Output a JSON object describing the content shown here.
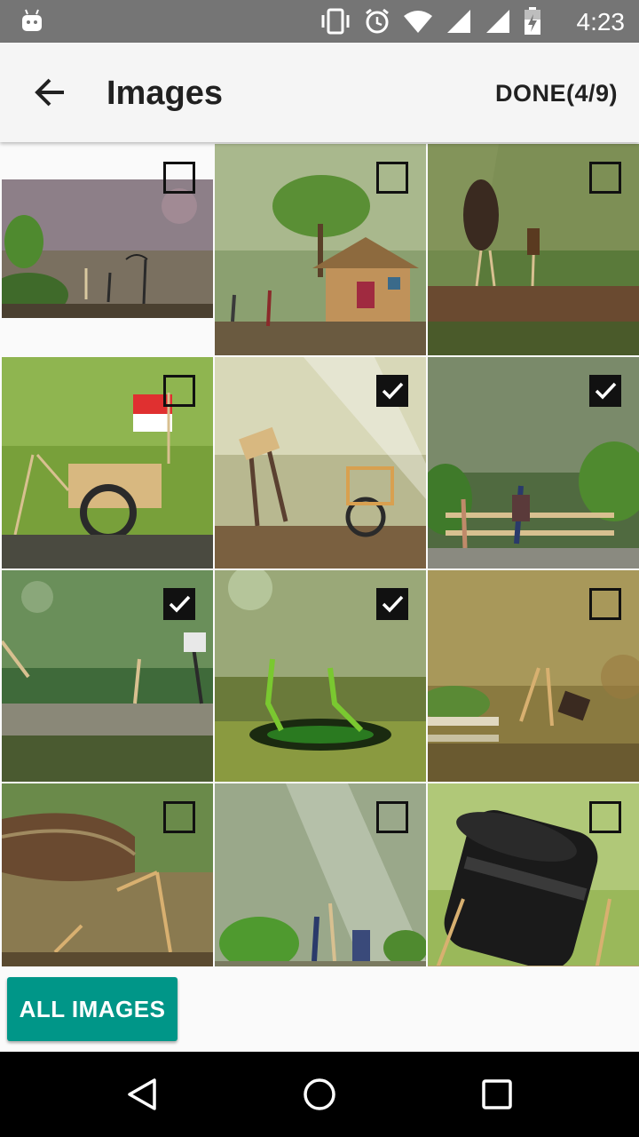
{
  "status_bar": {
    "time": "4:23",
    "icons": [
      "android-icon",
      "vibrate-icon",
      "alarm-icon",
      "wifi-icon",
      "signal-icon",
      "signal-icon",
      "battery-icon"
    ]
  },
  "app_bar": {
    "title": "Images",
    "done_label": "DONE(4/9)",
    "back_icon": "arrow-back-icon"
  },
  "grid": {
    "images": [
      {
        "label": "matchstick figures in rain",
        "selected": false
      },
      {
        "label": "matchstick figures by wooden house",
        "selected": false
      },
      {
        "label": "matchstick figures on branch",
        "selected": false
      },
      {
        "label": "matchstick cart with flag",
        "selected": false
      },
      {
        "label": "matchstick figure with wheelchair",
        "selected": true
      },
      {
        "label": "matchstick couple on bench",
        "selected": true
      },
      {
        "label": "matchstick figures on log",
        "selected": true
      },
      {
        "label": "matchstick figure in hole",
        "selected": true
      },
      {
        "label": "matchstick figures at bench",
        "selected": false
      },
      {
        "label": "matchstick figures under shoe",
        "selected": false
      },
      {
        "label": "matchstick figures in forest",
        "selected": false
      },
      {
        "label": "matchstick figures with camera lens",
        "selected": false
      }
    ]
  },
  "bottom": {
    "all_images_label": "ALL IMAGES"
  },
  "colors": {
    "accent": "#009688",
    "status_bar": "#757575",
    "app_bar": "#f5f5f5"
  }
}
